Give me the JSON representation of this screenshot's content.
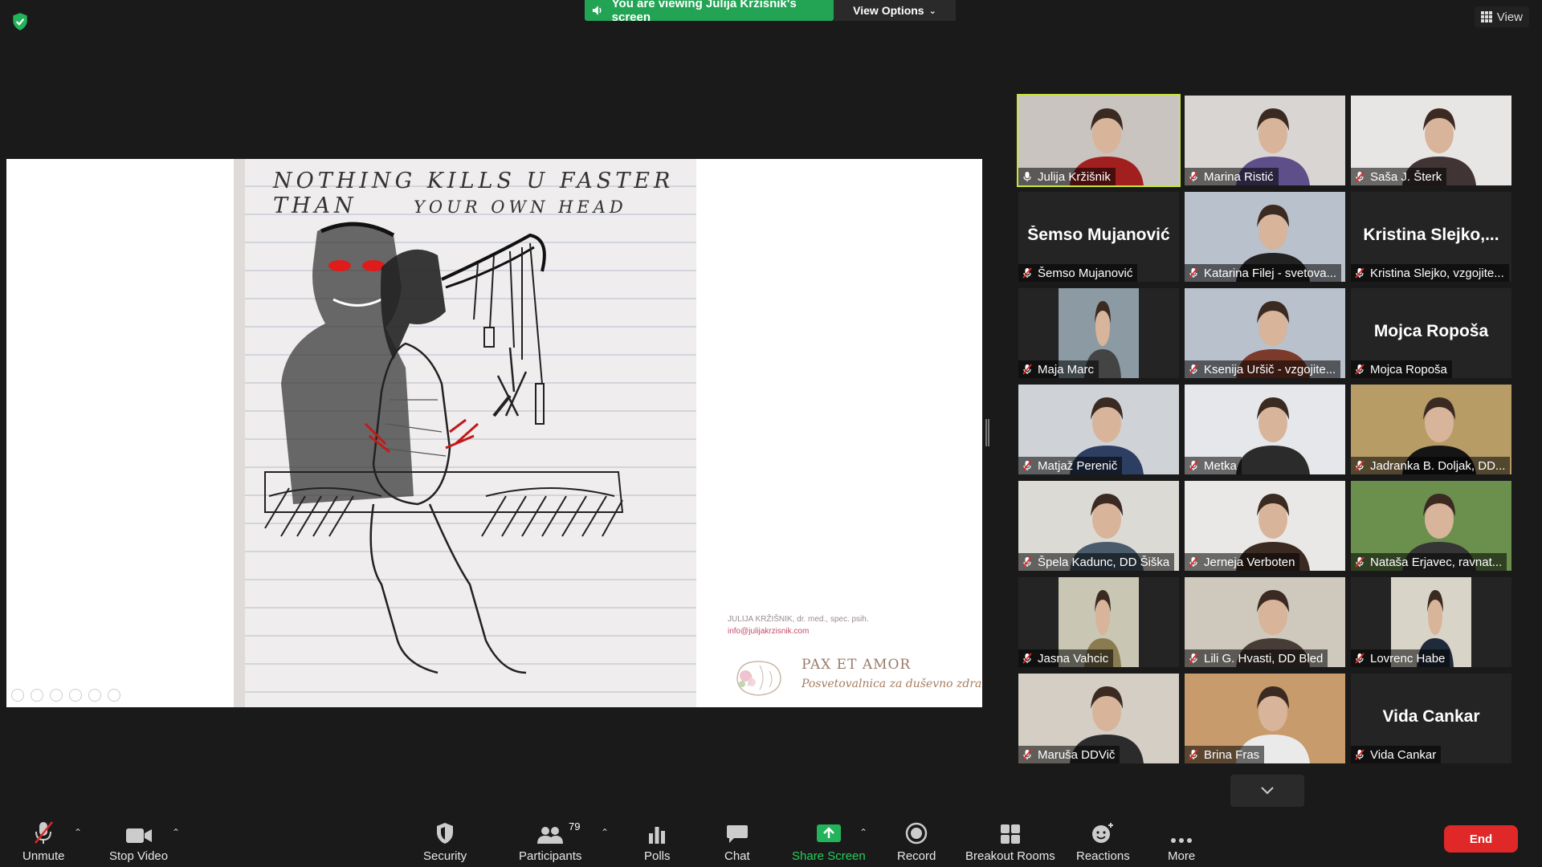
{
  "top_bar": {
    "share_banner": "You are viewing Julija Kržišnik's screen",
    "view_options": "View Options",
    "view_button": "View"
  },
  "shared_screen": {
    "drawing_caption_line1": "NOTHING KILLS U FASTER THAN",
    "drawing_caption_line2": "YOUR OWN HEAD",
    "brand_credit": "JULIJA KRŽIŠNIK, dr. med., spec. psih.",
    "brand_email": "info@julijakrzisnik.com",
    "brand_name": "PAX ET AMOR",
    "brand_tagline": "Posvetovalnica za duševno zdravje"
  },
  "gallery": {
    "tiles": [
      {
        "name": "Julija Kržišnik",
        "type": "video",
        "active": true,
        "bg": "#c9c4c0",
        "shirt": "#a1201f",
        "mic": "unmuted"
      },
      {
        "name": "Marina Ristić",
        "type": "video",
        "bg": "#d9d5d2",
        "shirt": "#5e4f8a",
        "mic": "muted"
      },
      {
        "name": "Saša J. Šterk",
        "type": "video",
        "bg": "#e8e6e4",
        "shirt": "#403434",
        "mic": "muted"
      },
      {
        "name": "Šemso Mujanović",
        "type": "name",
        "big": "Šemso Mujanović",
        "mic": "muted"
      },
      {
        "name": "Katarina Filej - svetova...",
        "type": "video",
        "bg": "#b9c1cc",
        "shirt": "#222",
        "mic": "muted"
      },
      {
        "name": "Kristina Slejko, vzgojite...",
        "type": "name",
        "big": "Kristina Slejko,...",
        "mic": "muted"
      },
      {
        "name": "Maja Marc",
        "type": "photo",
        "bg": "#8b9aa3",
        "shirt": "#444",
        "mic": "muted"
      },
      {
        "name": "Ksenija Uršič - vzgojite...",
        "type": "video",
        "bg": "#b9c1cc",
        "shirt": "#7c3a2a",
        "mic": "muted"
      },
      {
        "name": "Mojca Ropoša",
        "type": "name",
        "big": "Mojca Ropoša",
        "mic": "muted"
      },
      {
        "name": "Matjaž Perenič",
        "type": "video",
        "bg": "#cfd2d6",
        "shirt": "#2d3e63",
        "mic": "muted"
      },
      {
        "name": "Metka",
        "type": "video",
        "bg": "#e6e7ea",
        "shirt": "#2b2b2b",
        "mic": "muted"
      },
      {
        "name": "Jadranka B. Doljak, DD...",
        "type": "video",
        "bg": "#b79c66",
        "shirt": "#151515",
        "mic": "muted"
      },
      {
        "name": "Špela Kadunc, DD Šiška",
        "type": "video",
        "bg": "#dcdad5",
        "shirt": "#4a5b6b",
        "mic": "muted"
      },
      {
        "name": "Jerneja Verboten",
        "type": "video",
        "bg": "#e9e8e6",
        "shirt": "#3b2a22",
        "mic": "muted"
      },
      {
        "name": "Nataša Erjavec, ravnat...",
        "type": "video",
        "bg": "#6b8f4c",
        "shirt": "#353535",
        "mic": "muted"
      },
      {
        "name": "Jasna Vahcic",
        "type": "photo",
        "bg": "#c9c7b4",
        "shirt": "#8b7b51",
        "mic": "muted"
      },
      {
        "name": "Lili G. Hvasti, DD Bled",
        "type": "video",
        "bg": "#cfc8bd",
        "shirt": "#473d36",
        "mic": "muted"
      },
      {
        "name": "Lovrenc Habe",
        "type": "photo",
        "bg": "#d9d4c8",
        "shirt": "#1f2a3a",
        "mic": "muted"
      },
      {
        "name": "Maruša DDVič",
        "type": "video",
        "bg": "#d4cec5",
        "shirt": "#2b2b2b",
        "mic": "muted"
      },
      {
        "name": "Brina Fras",
        "type": "video",
        "bg": "#c79b6b",
        "shirt": "#eaeaea",
        "mic": "muted"
      },
      {
        "name": "Vida Cankar",
        "type": "name",
        "big": "Vida Cankar",
        "mic": "muted"
      }
    ]
  },
  "toolbar": {
    "unmute": "Unmute",
    "stop_video": "Stop Video",
    "security": "Security",
    "participants": "Participants",
    "participants_count": "79",
    "polls": "Polls",
    "chat": "Chat",
    "share_screen": "Share Screen",
    "record": "Record",
    "breakout_rooms": "Breakout Rooms",
    "reactions": "Reactions",
    "more": "More",
    "end": "End"
  }
}
